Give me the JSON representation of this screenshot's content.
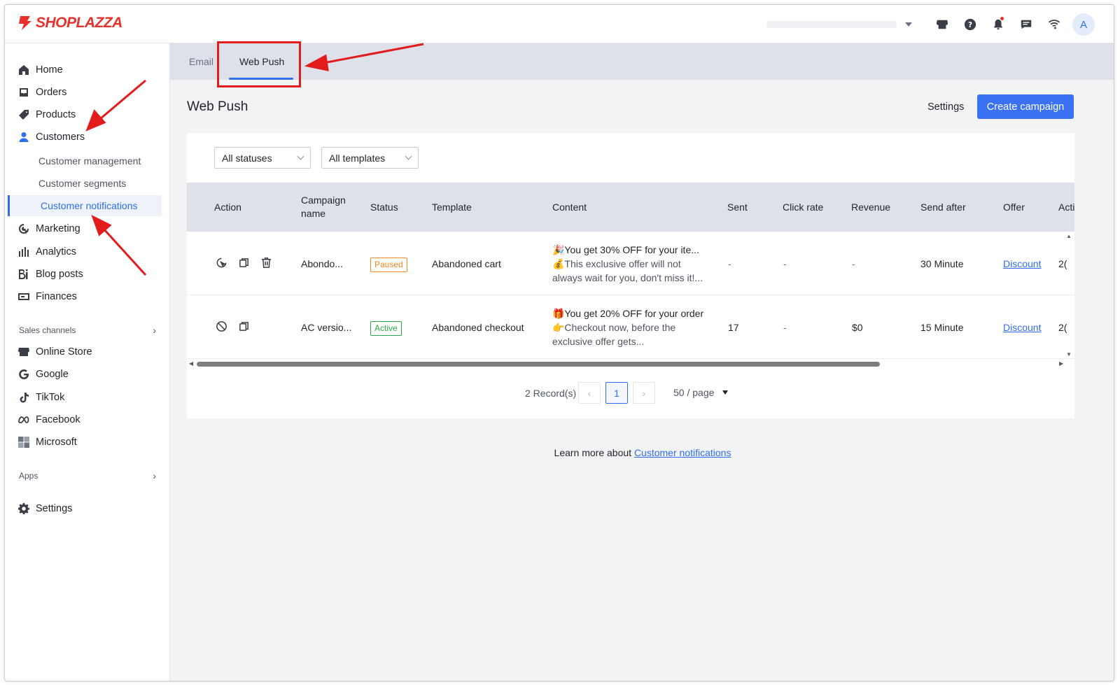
{
  "brand": {
    "name": "SHOPLAZZA",
    "color": "#e8312b"
  },
  "topbar": {
    "icons": [
      "store-icon",
      "help-icon",
      "bell-icon",
      "message-icon",
      "wifi-icon"
    ],
    "avatar_letter": "A"
  },
  "sidebar": {
    "items": [
      {
        "label": "Home",
        "icon": "home-icon"
      },
      {
        "label": "Orders",
        "icon": "orders-icon"
      },
      {
        "label": "Products",
        "icon": "tag-icon"
      },
      {
        "label": "Customers",
        "icon": "user-icon"
      }
    ],
    "customer_sub": [
      {
        "label": "Customer management"
      },
      {
        "label": "Customer segments"
      },
      {
        "label": "Customer notifications"
      }
    ],
    "items2": [
      {
        "label": "Marketing",
        "icon": "marketing-icon"
      },
      {
        "label": "Analytics",
        "icon": "analytics-icon"
      },
      {
        "label": "Blog posts",
        "icon": "blog-icon"
      },
      {
        "label": "Finances",
        "icon": "finance-icon"
      }
    ],
    "sales_channels_label": "Sales channels",
    "channels": [
      {
        "label": "Online Store",
        "icon": "store-icon"
      },
      {
        "label": "Google",
        "icon": "google-icon"
      },
      {
        "label": "TikTok",
        "icon": "tiktok-icon"
      },
      {
        "label": "Facebook",
        "icon": "meta-icon"
      },
      {
        "label": "Microsoft",
        "icon": "microsoft-icon"
      }
    ],
    "apps_label": "Apps",
    "settings_label": "Settings"
  },
  "tabs": [
    {
      "label": "Email"
    },
    {
      "label": "Web Push"
    }
  ],
  "page": {
    "title": "Web Push",
    "settings_label": "Settings",
    "create_label": "Create campaign"
  },
  "filters": {
    "status": "All statuses",
    "template": "All templates"
  },
  "table": {
    "headers": {
      "action": "Action",
      "campaign1": "Campaign",
      "campaign2": "name",
      "status": "Status",
      "template": "Template",
      "content": "Content",
      "sent": "Sent",
      "click_rate": "Click rate",
      "revenue": "Revenue",
      "send_after": "Send after",
      "offer": "Offer",
      "acti": "Acti"
    },
    "rows": [
      {
        "name": "Abondo...",
        "status": "Paused",
        "template": "Abandoned cart",
        "content_l1": "🎉You get 30% OFF for your ite...",
        "content_l2": "💰This exclusive offer will not",
        "content_l3": "always wait for you, don't miss it!...",
        "sent": "-",
        "click_rate": "-",
        "revenue": "-",
        "send_after": "30 Minute",
        "offer": "Discount",
        "acti": "2("
      },
      {
        "name": "AC versio...",
        "status": "Active",
        "template": "Abandoned checkout",
        "content_l1": "🎁You get 20% OFF for your order",
        "content_l2": "👉Checkout now, before the",
        "content_l3": "exclusive offer gets...",
        "sent": "17",
        "click_rate": "-",
        "revenue": "$0",
        "send_after": "15 Minute",
        "offer": "Discount",
        "acti": "2("
      }
    ]
  },
  "pagination": {
    "records": "2 Record(s)",
    "current": "1",
    "per_page": "50 / page"
  },
  "footer": {
    "learn_text": "Learn more about ",
    "learn_link": "Customer notifications"
  },
  "colors": {
    "accent": "#3b71f3",
    "annotation": "#e21b1b"
  }
}
